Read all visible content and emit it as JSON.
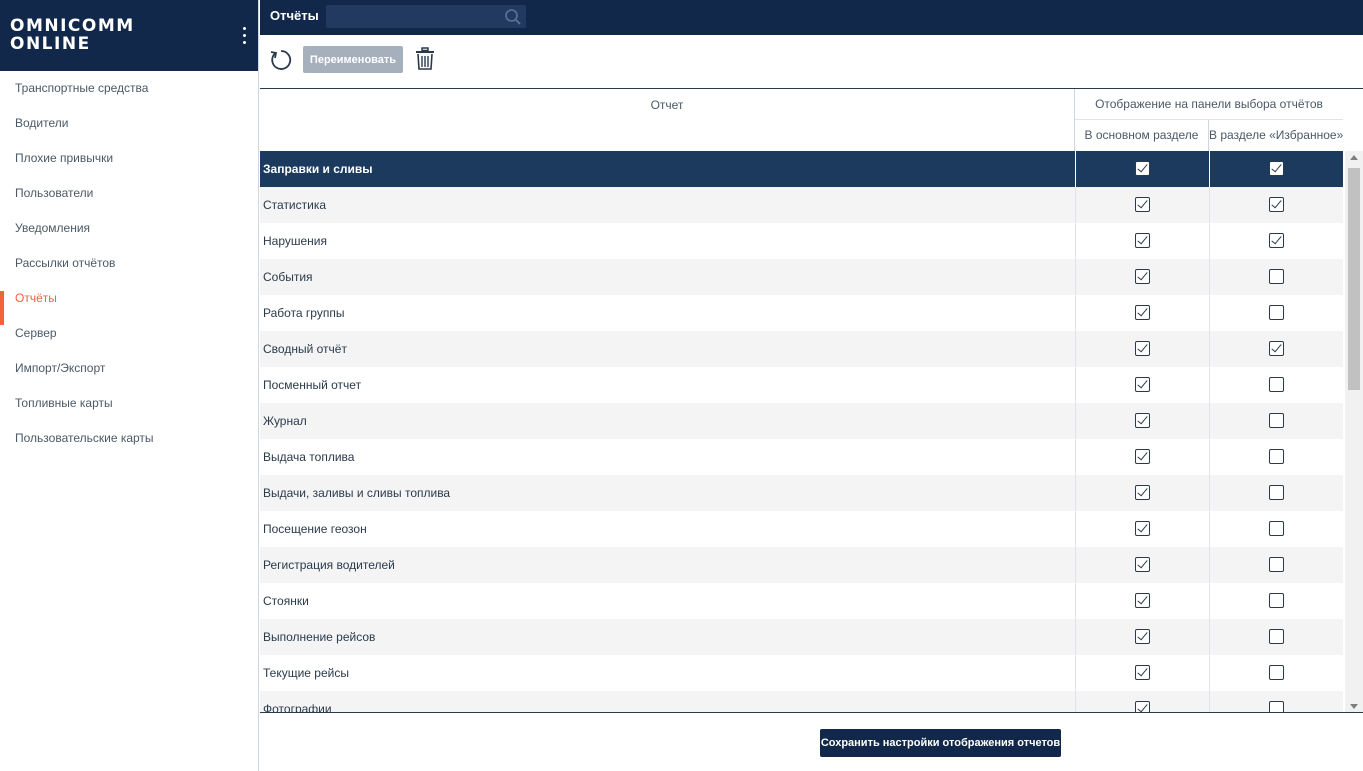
{
  "app": {
    "logo_line1": "OMNICOMM",
    "logo_line2": "ONLINE"
  },
  "sidebar": {
    "items": [
      {
        "label": "Транспортные средства",
        "active": false
      },
      {
        "label": "Водители",
        "active": false
      },
      {
        "label": "Плохие привычки",
        "active": false
      },
      {
        "label": "Пользователи",
        "active": false
      },
      {
        "label": "Уведомления",
        "active": false
      },
      {
        "label": "Рассылки отчётов",
        "active": false
      },
      {
        "label": "Отчёты",
        "active": true
      },
      {
        "label": "Сервер",
        "active": false
      },
      {
        "label": "Импорт/Экспорт",
        "active": false
      },
      {
        "label": "Топливные карты",
        "active": false
      },
      {
        "label": "Пользовательские карты",
        "active": false
      }
    ]
  },
  "header": {
    "title": "Отчёты",
    "search_value": ""
  },
  "toolbar": {
    "refresh_icon": "refresh-icon",
    "rename_label": "Переименовать",
    "delete_icon": "trash-icon"
  },
  "table": {
    "col_report": "Отчет",
    "col_group": "Отображение на панели выбора отчётов",
    "col_main": "В основном разделе",
    "col_fav": "В разделе «Избранное»",
    "rows": [
      {
        "name": "Заправки и сливы",
        "main": true,
        "fav": true,
        "selected": true
      },
      {
        "name": "Статистика",
        "main": true,
        "fav": true
      },
      {
        "name": "Нарушения",
        "main": true,
        "fav": true
      },
      {
        "name": "События",
        "main": true,
        "fav": false
      },
      {
        "name": "Работа группы",
        "main": true,
        "fav": false
      },
      {
        "name": "Сводный отчёт",
        "main": true,
        "fav": true
      },
      {
        "name": "Посменный отчет",
        "main": true,
        "fav": false
      },
      {
        "name": "Журнал",
        "main": true,
        "fav": false
      },
      {
        "name": "Выдача топлива",
        "main": true,
        "fav": false
      },
      {
        "name": "Выдачи, заливы и сливы топлива",
        "main": true,
        "fav": false
      },
      {
        "name": "Посещение геозон",
        "main": true,
        "fav": false
      },
      {
        "name": "Регистрация водителей",
        "main": true,
        "fav": false
      },
      {
        "name": "Стоянки",
        "main": true,
        "fav": false
      },
      {
        "name": "Выполнение рейсов",
        "main": true,
        "fav": false
      },
      {
        "name": "Текущие рейсы",
        "main": true,
        "fav": false
      },
      {
        "name": "Фотографии",
        "main": true,
        "fav": false
      }
    ]
  },
  "footer": {
    "save_label": "Сохранить настройки отображения отчетов"
  },
  "colors": {
    "brand_dark": "#12284a",
    "selected_row": "#1b3a5e",
    "accent": "#f0643c",
    "disabled_button": "#a6b0bc"
  }
}
